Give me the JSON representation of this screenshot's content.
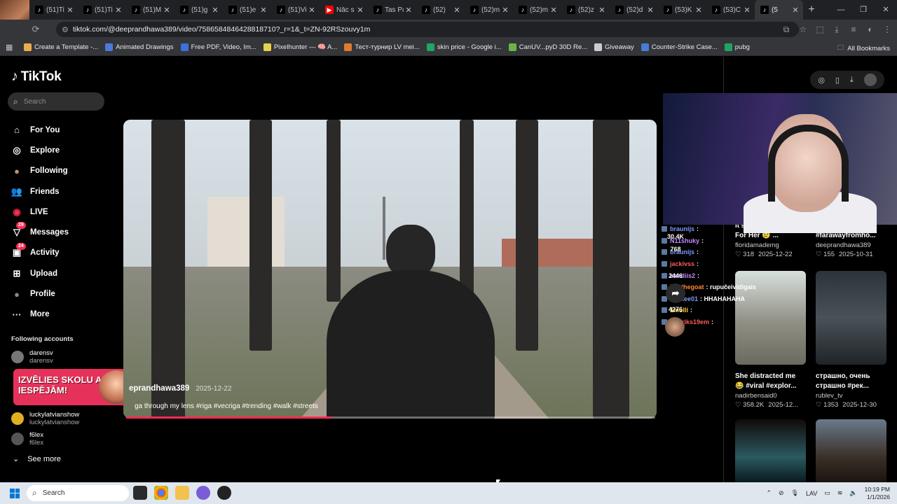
{
  "browser": {
    "tabs": [
      {
        "title": "(51)Ti",
        "icon": "tiktok-icon"
      },
      {
        "title": "(51)Ti",
        "icon": "tiktok-icon"
      },
      {
        "title": "(51)M",
        "icon": "tiktok-icon"
      },
      {
        "title": "(51)g",
        "icon": "tiktok-icon"
      },
      {
        "title": "(51)e",
        "icon": "tiktok-icon"
      },
      {
        "title": "(51)Vi",
        "icon": "tiktok-icon"
      },
      {
        "title": "Nāc s",
        "icon": "youtube-icon"
      },
      {
        "title": "Tas Pa",
        "icon": "tiktok-icon"
      },
      {
        "title": "(52)",
        "icon": "tiktok-icon"
      },
      {
        "title": "(52)m",
        "icon": "tiktok-icon"
      },
      {
        "title": "(52)m",
        "icon": "tiktok-icon"
      },
      {
        "title": "(52)z",
        "icon": "tiktok-icon"
      },
      {
        "title": "(52)d",
        "icon": "tiktok-icon"
      },
      {
        "title": "(53)K",
        "icon": "tiktok-icon"
      },
      {
        "title": "(53)C",
        "icon": "tiktok-icon"
      },
      {
        "title": "(5",
        "icon": "tiktok-icon",
        "active": true
      }
    ],
    "url": "tiktok.com/@deeprandhawa389/video/7586584846428818710?_r=1&_t=ZN-92RSzouvy1m",
    "bookmarks": [
      {
        "label": "Create a Template -...",
        "color": "#e8b04a"
      },
      {
        "label": "Animated Drawings",
        "color": "#4a7bd8"
      },
      {
        "label": "Free PDF, Video, Im...",
        "color": "#3d6fe0"
      },
      {
        "label": "Pixelhunter — 🧠 A...",
        "color": "#e8d24a"
      },
      {
        "label": "Тест-турнир LV mei...",
        "color": "#e07a2e"
      },
      {
        "label": "skin price - Google i...",
        "color": "#21a464"
      },
      {
        "label": "CanUV...pyD 30D Re...",
        "color": "#6bb34a"
      },
      {
        "label": "Giveaway",
        "color": "#cccccc"
      },
      {
        "label": "Counter-Strike Case...",
        "color": "#4a7bd8"
      },
      {
        "label": "pubg",
        "color": "#21a464"
      }
    ],
    "all_bookmarks": "All Bookmarks"
  },
  "sidebar": {
    "logo": "TikTok",
    "search_placeholder": "Search",
    "nav": [
      {
        "label": "For You",
        "icon": "home-icon"
      },
      {
        "label": "Explore",
        "icon": "compass-icon"
      },
      {
        "label": "Following",
        "icon": "following-avatar-icon"
      },
      {
        "label": "Friends",
        "icon": "friends-icon"
      },
      {
        "label": "LIVE",
        "icon": "live-icon"
      },
      {
        "label": "Messages",
        "icon": "messages-icon",
        "badge": "29"
      },
      {
        "label": "Activity",
        "icon": "activity-icon",
        "badge": "24"
      },
      {
        "label": "Upload",
        "icon": "upload-icon"
      },
      {
        "label": "Profile",
        "icon": "profile-avatar-icon"
      },
      {
        "label": "More",
        "icon": "more-icon"
      }
    ],
    "following_title": "Following accounts",
    "following": [
      {
        "name": "darensv",
        "handle": "darensv",
        "color": "#777"
      },
      {
        "name": "luckylatvianshow",
        "handle": "luckylatvianshow",
        "color": "#e0b020"
      },
      {
        "name": "f6lex",
        "handle": "f6lex",
        "color": "#555"
      }
    ],
    "see_more": "See more",
    "promo_text": "IZVĒLIES SKOLU AR IESPĒJĀM!"
  },
  "video": {
    "author": "eprandhawa389",
    "date": "2025-12-22",
    "caption": "ga through my lens #riga #vecriga #trending #walk #streets",
    "progress": 0.39
  },
  "chat": [
    {
      "user": "braunijs",
      "text": ":",
      "color": "#7b9cff"
    },
    {
      "user": "N11shuky",
      "text": ":",
      "color": "#c08bff"
    },
    {
      "user": "braunijs",
      "text": ":",
      "color": "#7b9cff"
    },
    {
      "user": "jackivss",
      "text": ":",
      "color": "#ff5a5a"
    },
    {
      "user": "kandiis2",
      "text": ":",
      "color": "#c08bff"
    },
    {
      "user": "benthegoat",
      "text": ": rupučeivīdigais",
      "color": "#ff8a3a"
    },
    {
      "user": "wolkee01",
      "text": ": HHAHAHAHA",
      "color": "#7b9cff"
    },
    {
      "user": "1molli",
      "text": ":",
      "color": "#ffcf3a"
    },
    {
      "user": "arturiks19em",
      "text": ":",
      "color": "#ff5a5a"
    }
  ],
  "actions": {
    "likes": "30.4K",
    "comments": "768",
    "saves": "2446",
    "shares": "4276"
  },
  "recommendations": [
    {
      "title": "It's Not Even Sour For Her 😢 ...",
      "author": "floridamademg",
      "views": "318",
      "date": "2025-12-22"
    },
    {
      "title": "#treand #friends #farawayfromho...",
      "author": "deeprandhawa389",
      "views": "155",
      "date": "2025-10-31"
    },
    {
      "title": "She distracted me 😂 #viral #explor...",
      "author": "nadirbensaid0",
      "views": "358.2K",
      "date": "2025-12..."
    },
    {
      "title": "страшно, очень страшно #рек...",
      "author": "rublev_tv",
      "views": "1353",
      "date": "2025-12-30"
    }
  ],
  "taskbar": {
    "search_placeholder": "Search",
    "lang": "LAV",
    "time": "10:19 PM",
    "date": "1/1/2026"
  }
}
